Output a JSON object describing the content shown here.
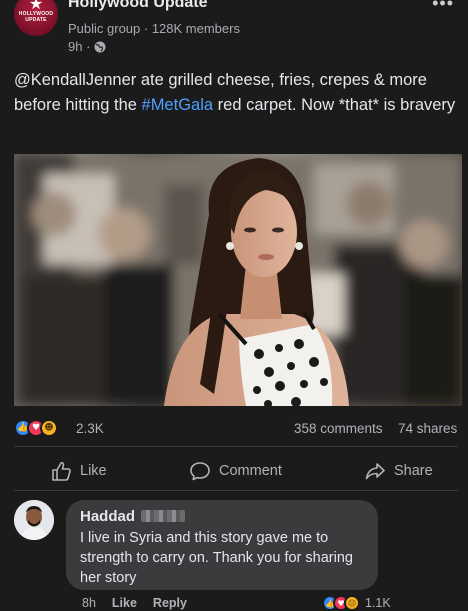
{
  "group": {
    "name": "Hollywood Update",
    "logo_text": "HOLLYWOOD UPDATE",
    "meta": "Public group · 128K members",
    "time": "9h ·"
  },
  "post": {
    "text_pre": "@KendallJenner ate grilled cheese, fries, crepes & more before hitting the ",
    "hashtag": "#MetGala",
    "text_post": " red carpet. Now *that* is bravery"
  },
  "stats": {
    "reactions": "2.3K",
    "comments": "358 comments",
    "shares": "74 shares"
  },
  "actions": {
    "like": "Like",
    "comment": "Comment",
    "share": "Share"
  },
  "comment": {
    "author": "Haddad",
    "text": "I live in Syria and this story gave me to strength to carry on. Thank you for sharing her story",
    "time": "8h",
    "like": "Like",
    "reply": "Reply",
    "reaction_count": "1.1K"
  },
  "colors": {
    "background": "#1b1b1c",
    "hashtag": "#4ea0ff",
    "bubble": "#3a3b3c",
    "like_blue": "#2d88ff",
    "love_red": "#f0385a",
    "haha_yellow": "#f7b125"
  },
  "icons": {
    "globe": "globe-icon",
    "more": "more-options-icon",
    "like": "thumbs-up-icon",
    "comment": "speech-bubble-icon",
    "share": "share-arrow-icon"
  }
}
